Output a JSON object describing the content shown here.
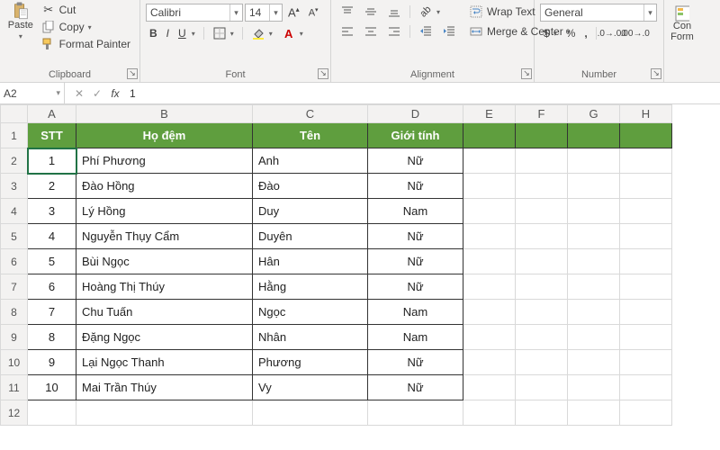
{
  "ribbon": {
    "clipboard": {
      "paste": "Paste",
      "cut": "Cut",
      "copy": "Copy",
      "format_painter": "Format Painter",
      "title": "Clipboard"
    },
    "font": {
      "name": "Calibri",
      "size": "14",
      "title": "Font"
    },
    "alignment": {
      "wrap": "Wrap Text",
      "merge": "Merge & Center",
      "title": "Alignment"
    },
    "number": {
      "format": "General",
      "title": "Number"
    },
    "cells": {
      "con": "Con",
      "form": "Form"
    }
  },
  "bar": {
    "namebox": "A2",
    "formula": "1"
  },
  "cols": [
    "A",
    "B",
    "C",
    "D",
    "E",
    "F",
    "G",
    "H"
  ],
  "rows": [
    "1",
    "2",
    "3",
    "4",
    "5",
    "6",
    "7",
    "8",
    "9",
    "10",
    "11",
    "12"
  ],
  "headers": [
    "STT",
    "Họ đệm",
    "Tên",
    "Giới tính"
  ],
  "data": [
    [
      "1",
      "Phí Phương",
      "Anh",
      "Nữ"
    ],
    [
      "2",
      "Đào Hồng",
      "Đào",
      "Nữ"
    ],
    [
      "3",
      "Lý Hồng",
      "Duy",
      "Nam"
    ],
    [
      "4",
      "Nguyễn Thụy Cẩm",
      "Duyên",
      "Nữ"
    ],
    [
      "5",
      "Bùi Ngọc",
      "Hân",
      "Nữ"
    ],
    [
      "6",
      "Hoàng Thị Thúy",
      "Hằng",
      "Nữ"
    ],
    [
      "7",
      "Chu Tuấn",
      "Ngọc",
      "Nam"
    ],
    [
      "8",
      "Đặng Ngọc",
      "Nhân",
      "Nam"
    ],
    [
      "9",
      "Lại Ngọc Thanh",
      "Phương",
      "Nữ"
    ],
    [
      "10",
      "Mai Trần Thúy",
      "Vy",
      "Nữ"
    ]
  ],
  "chart_data": {
    "type": "table",
    "columns": [
      "STT",
      "Họ đệm",
      "Tên",
      "Giới tính"
    ],
    "rows": [
      [
        1,
        "Phí Phương",
        "Anh",
        "Nữ"
      ],
      [
        2,
        "Đào Hồng",
        "Đào",
        "Nữ"
      ],
      [
        3,
        "Lý Hồng",
        "Duy",
        "Nam"
      ],
      [
        4,
        "Nguyễn Thụy Cẩm",
        "Duyên",
        "Nữ"
      ],
      [
        5,
        "Bùi Ngọc",
        "Hân",
        "Nữ"
      ],
      [
        6,
        "Hoàng Thị Thúy",
        "Hằng",
        "Nữ"
      ],
      [
        7,
        "Chu Tuấn",
        "Ngọc",
        "Nam"
      ],
      [
        8,
        "Đặng Ngọc",
        "Nhân",
        "Nam"
      ],
      [
        9,
        "Lại Ngọc Thanh",
        "Phương",
        "Nữ"
      ],
      [
        10,
        "Mai Trần Thúy",
        "Vy",
        "Nữ"
      ]
    ]
  }
}
